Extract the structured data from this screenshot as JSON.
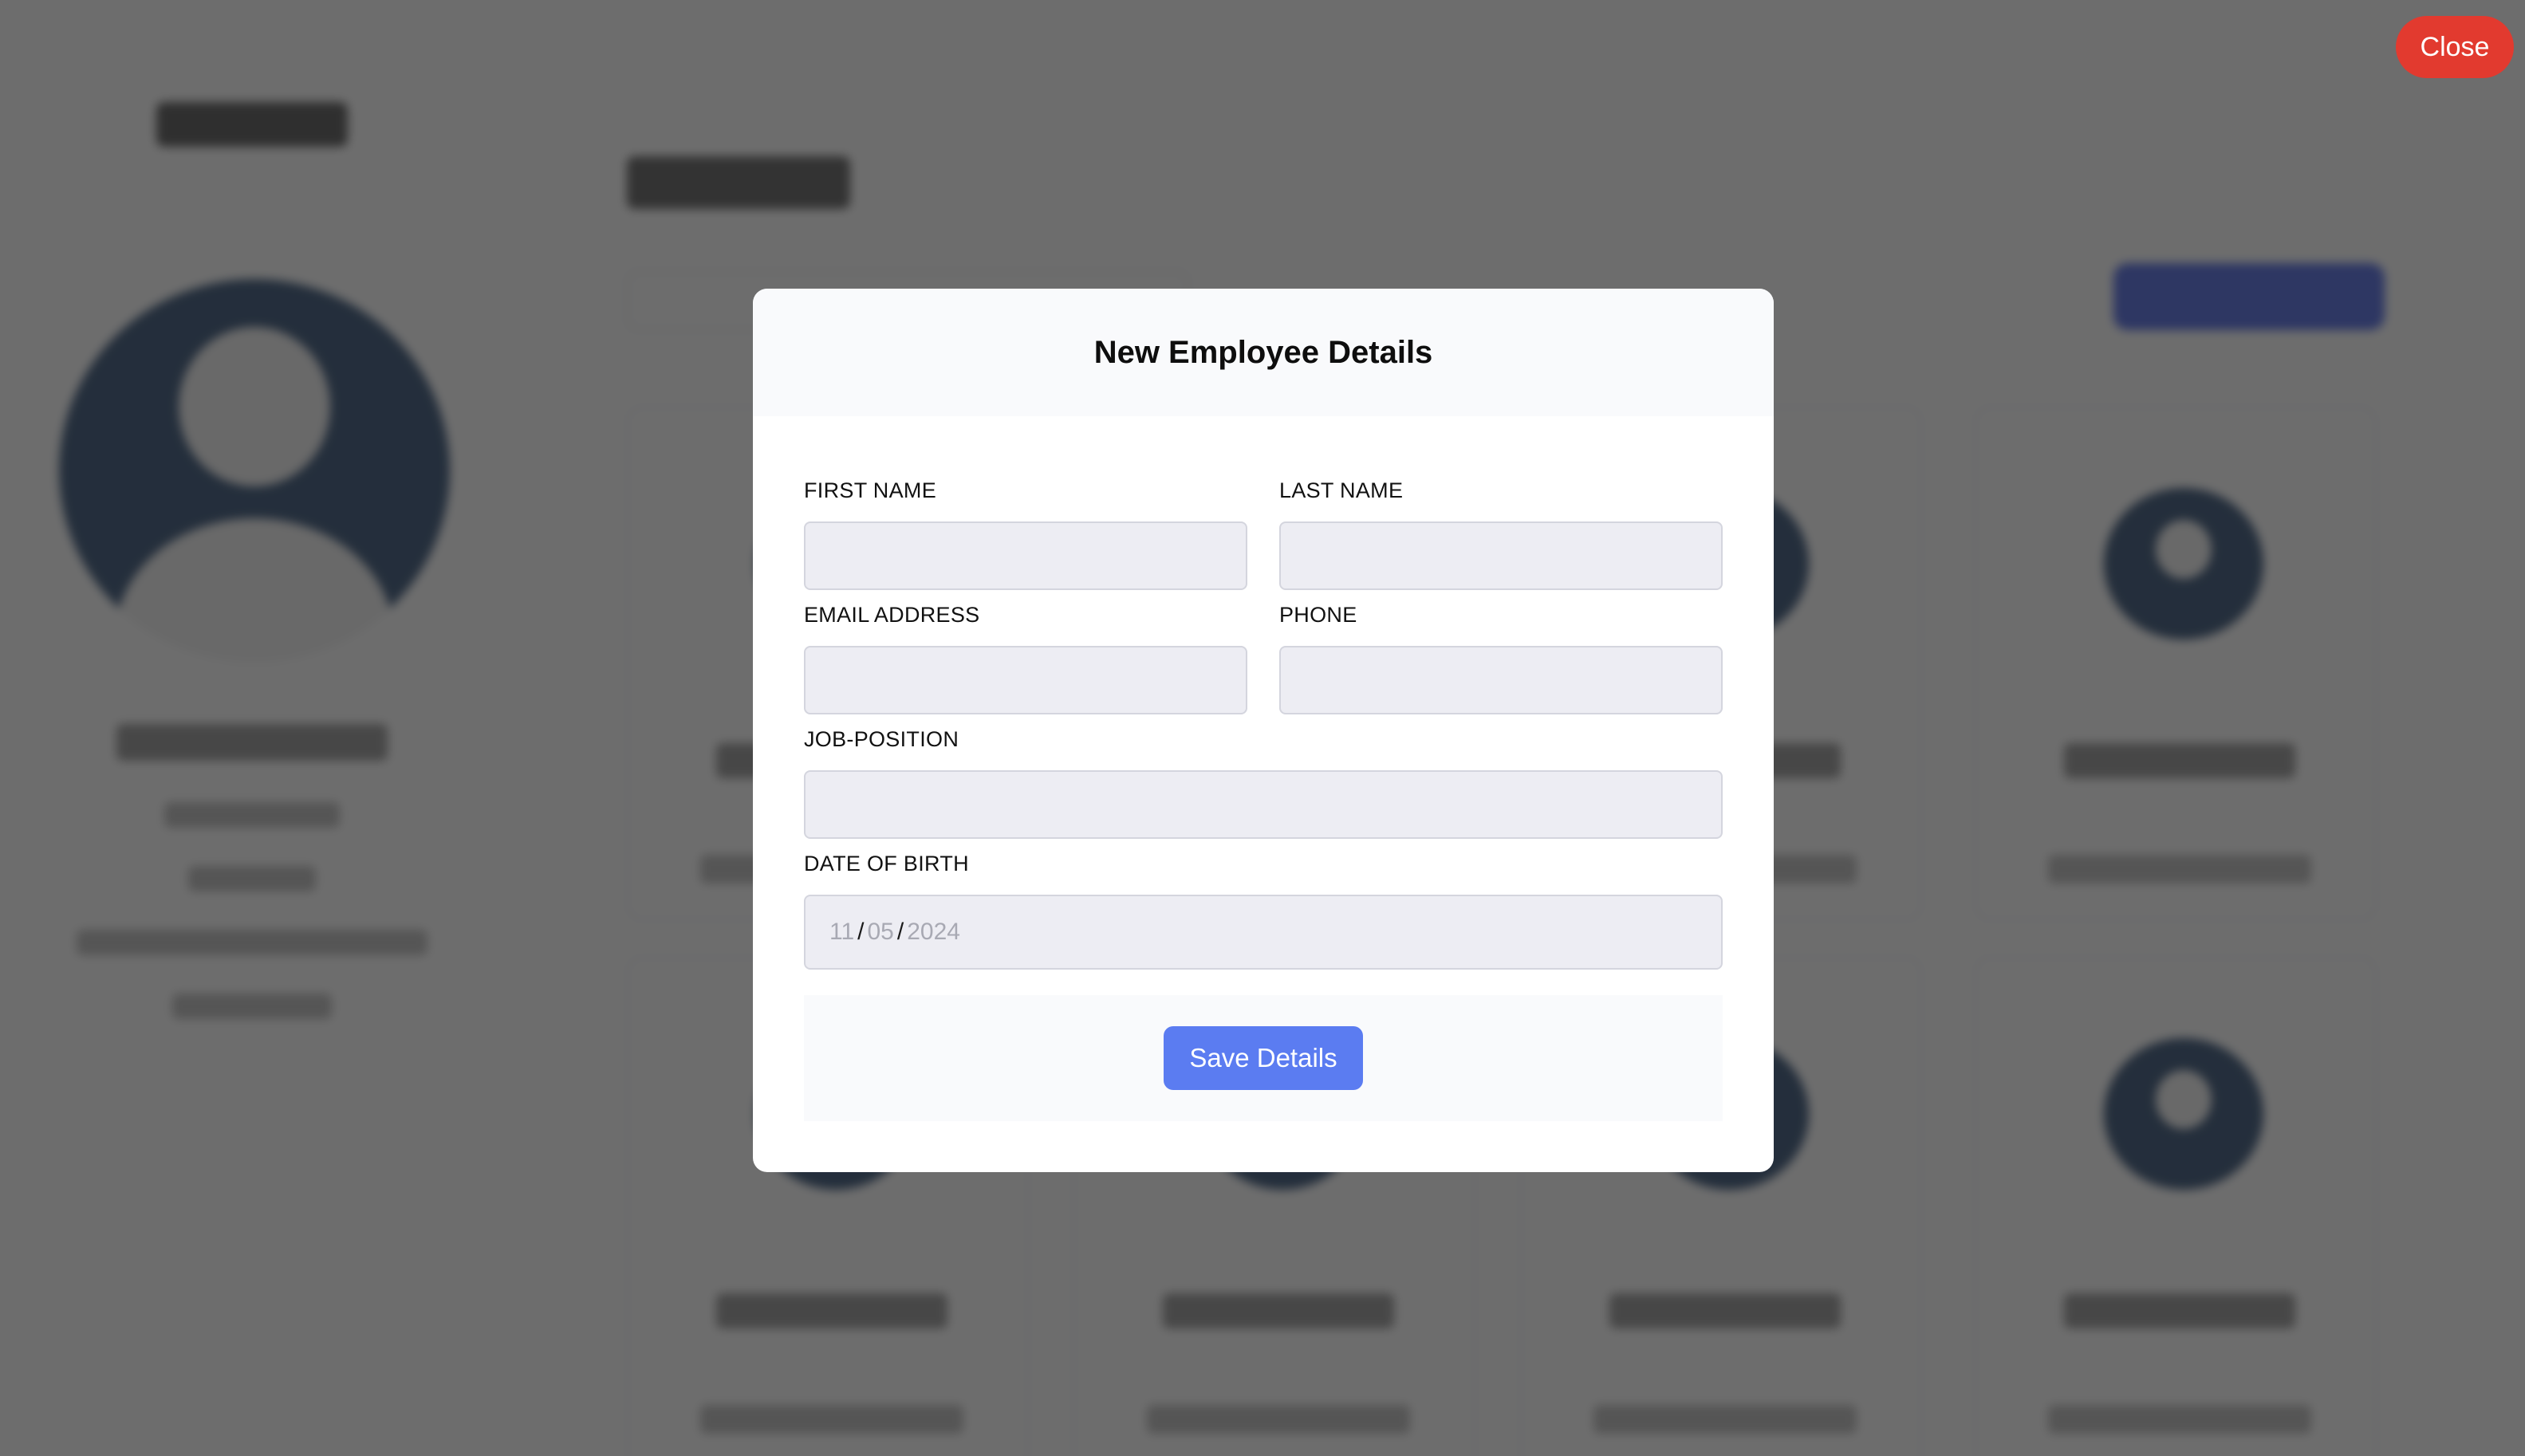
{
  "overlay": {
    "close_label": "Close"
  },
  "modal": {
    "title": "New Employee Details",
    "fields": {
      "first_name": {
        "label": "FIRST NAME",
        "value": ""
      },
      "last_name": {
        "label": "LAST NAME",
        "value": ""
      },
      "email": {
        "label": "EMAIL ADDRESS",
        "value": ""
      },
      "phone": {
        "label": "PHONE",
        "value": ""
      },
      "job_position": {
        "label": "JOB-POSITION",
        "value": ""
      },
      "date_of_birth": {
        "label": "DATE OF BIRTH",
        "month": "11",
        "day": "05",
        "year": "2024",
        "separator": "/"
      }
    },
    "save_label": "Save Details"
  },
  "colors": {
    "close_button": "#e23a2f",
    "save_button": "#5b7cf1",
    "input_background": "#ededf3",
    "overlay": "rgba(40, 40, 40, 0.68)"
  }
}
